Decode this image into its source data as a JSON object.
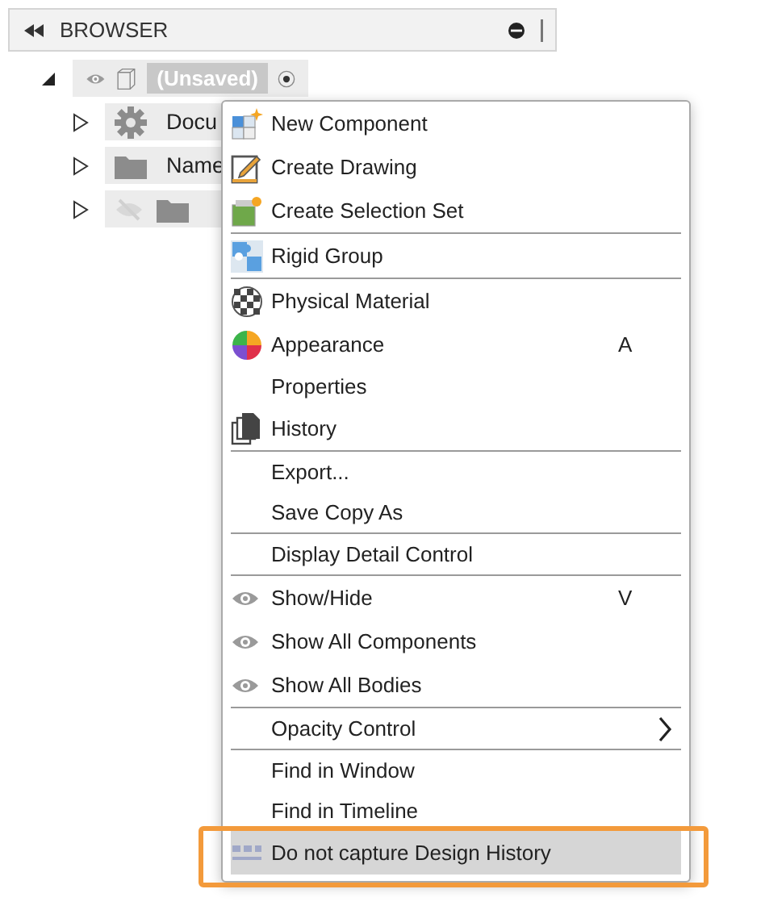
{
  "panel": {
    "title": "BROWSER"
  },
  "tree": {
    "label": "(Unsaved)",
    "expanded": true,
    "children": [
      {
        "kind": "gear",
        "label": "Docu",
        "expanded": false,
        "hidden": false
      },
      {
        "kind": "folder",
        "label": "Name",
        "expanded": false,
        "hidden": false
      },
      {
        "kind": "folder",
        "expanded": false,
        "hidden": true
      }
    ]
  },
  "menu": {
    "groups": [
      [
        {
          "kind": "component",
          "label": "New Component",
          "selected": false
        },
        {
          "kind": "drawing",
          "label": "Create Drawing",
          "selected": false
        },
        {
          "kind": "selection",
          "label": "Create Selection Set",
          "selected": false
        }
      ],
      [
        {
          "kind": "rigid",
          "label": "Rigid Group",
          "selected": false
        }
      ],
      [
        {
          "kind": "material",
          "label": "Physical Material",
          "selected": false
        },
        {
          "kind": "appearance",
          "label": "Appearance",
          "shortcut": "A",
          "selected": false
        },
        {
          "kind": "plain",
          "label": "Properties",
          "selected": false
        },
        {
          "kind": "history",
          "label": "History",
          "selected": false
        }
      ],
      [
        {
          "kind": "plain",
          "label": "Export...",
          "selected": false
        },
        {
          "kind": "plain",
          "label": "Save Copy As",
          "selected": false
        }
      ],
      [
        {
          "kind": "plain",
          "label": "Display Detail Control",
          "selected": false
        }
      ],
      [
        {
          "kind": "eye",
          "label": "Show/Hide",
          "shortcut": "V",
          "selected": false
        },
        {
          "kind": "eye",
          "label": "Show All Components",
          "selected": false
        },
        {
          "kind": "eye",
          "label": "Show All Bodies",
          "selected": false
        }
      ],
      [
        {
          "kind": "plain",
          "label": "Opacity Control",
          "submenu": true,
          "selected": false
        }
      ],
      [
        {
          "kind": "plain",
          "label": "Find in Window",
          "selected": false
        },
        {
          "kind": "plain",
          "label": "Find in Timeline",
          "selected": false
        },
        {
          "kind": "capture",
          "label": "Do not capture Design History",
          "selected": true,
          "outlined": true
        }
      ]
    ]
  }
}
